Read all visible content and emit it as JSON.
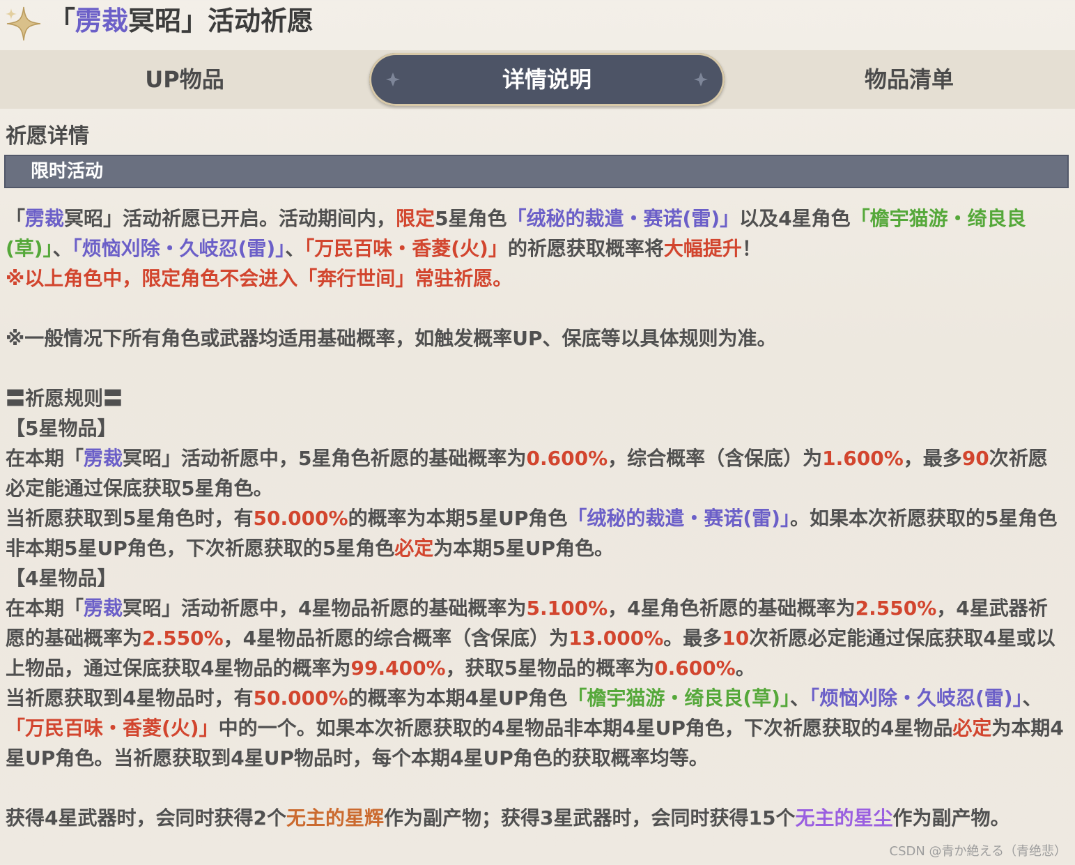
{
  "header": {
    "title_prefix": "「",
    "title_highlight": "雳裁",
    "title_rest": "冥昭」活动祈愿"
  },
  "tabs": {
    "up_items": "UP物品",
    "details": "详情说明",
    "item_list": "物品清单"
  },
  "section": {
    "title": "祈愿详情",
    "category": "限时活动"
  },
  "content": {
    "intro": [
      "「",
      "雳裁",
      "冥昭」活动祈愿已开启。活动期间内，",
      "限定",
      "5星角色",
      "「绒秘的裁遣・赛诺(雷)」",
      "以及4星角色",
      "「檐宇猫游・绮良良(草)」",
      "、",
      "「烦恼刈除・久岐忍(雷)」",
      "、",
      "「万民百味・香菱(火)」",
      "的祈愿获取概率将",
      "大幅提升",
      "！"
    ],
    "warning": "※以上角色中，限定角色不会进入「奔行世间」常驻祈愿。",
    "note": "※一般情况下所有角色或武器均适用基础概率，如触发概率UP、保底等以具体规则为准。",
    "rules_title": "〓祈愿规则〓",
    "five_star_header": "【5星物品】",
    "five_star_p1": [
      "在本期「",
      "雳裁",
      "冥昭」活动祈愿中，5星角色祈愿的基础概率为",
      "0.600%",
      "，综合概率（含保底）为",
      "1.600%",
      "，最多",
      "90",
      "次祈愿必定能通过保底获取5星角色。"
    ],
    "five_star_p2": [
      "当祈愿获取到5星角色时，有",
      "50.000%",
      "的概率为本期5星UP角色",
      "「绒秘的裁遣・赛诺(雷)」",
      "。如果本次祈愿获取的5星角色非本期5星UP角色，下次祈愿获取的5星角色",
      "必定",
      "为本期5星UP角色。"
    ],
    "four_star_header": "【4星物品】",
    "four_star_p1": [
      "在本期「",
      "雳裁",
      "冥昭」活动祈愿中，4星物品祈愿的基础概率为",
      "5.100%",
      "，4星角色祈愿的基础概率为",
      "2.550%",
      "，4星武器祈愿的基础概率为",
      "2.550%",
      "，4星物品祈愿的综合概率（含保底）为",
      "13.000%",
      "。最多",
      "10",
      "次祈愿必定能通过保底获取4星或以上物品，通过保底获取4星物品的概率为",
      "99.400%",
      "，获取5星物品的概率为",
      "0.600%",
      "。"
    ],
    "four_star_p2": [
      "当祈愿获取到4星物品时，有",
      "50.000%",
      "的概率为本期4星UP角色",
      "「檐宇猫游・绮良良(草)」",
      "、",
      "「烦恼刈除・久岐忍(雷)」",
      "、",
      "「万民百味・香菱(火)」",
      "中的一个。如果本次祈愿获取的4星物品非本期4星UP角色，下次祈愿获取的4星物品",
      "必定",
      "为本期4星UP角色。当祈愿获取到4星UP物品时，每个本期4星UP角色的获取概率均等。"
    ],
    "byproduct": [
      "获得4星武器时，会同时获得2个",
      "无主的星辉",
      "作为副产物；获得3星武器时，会同时获得15个",
      "无主的星尘",
      "作为副产物。"
    ]
  },
  "watermark": "CSDN @青か絶える（青绝悲）",
  "colors": {
    "purple_highlight": "#6b5fc8",
    "red_highlight": "#d2452e",
    "green_highlight": "#55a83a",
    "orange_highlight": "#cb6a2f",
    "violet_highlight": "#9a5fe0",
    "active_tab_bg": "#4d5466"
  }
}
